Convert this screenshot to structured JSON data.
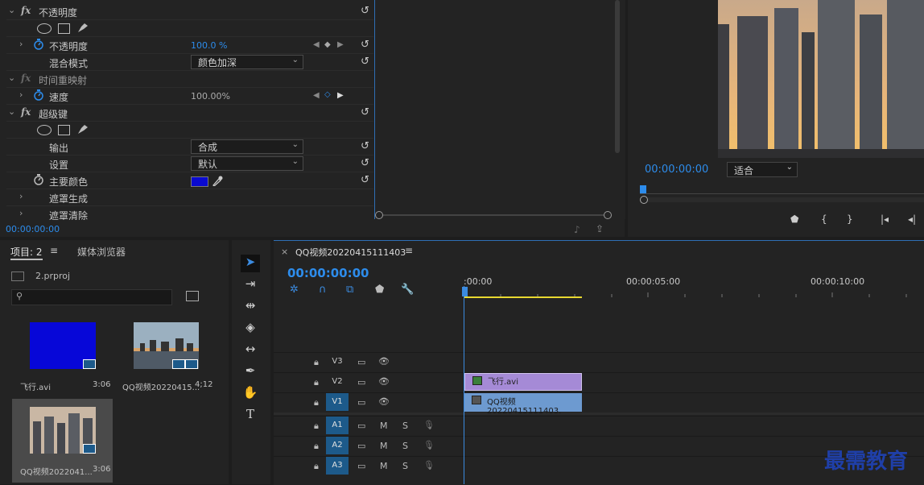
{
  "effects": {
    "opacity_title": "不透明度",
    "opacity_label": "不透明度",
    "opacity_value": "100.0 %",
    "blend_label": "混合模式",
    "blend_value": "颜色加深",
    "time_remap_title": "时间重映射",
    "speed_label": "速度",
    "speed_value": "100.00%",
    "ultrakey_title": "超级键",
    "output_label": "输出",
    "output_value": "合成",
    "settings_label": "设置",
    "settings_value": "默认",
    "key_color_label": "主要颜色",
    "key_color": "#0a0ad0",
    "matte_gen_label": "遮罩生成",
    "matte_clean_label": "遮罩清除",
    "fx_symbol": "fx",
    "timecode": "00:00:00:00"
  },
  "program": {
    "timecode": "00:00:00:00",
    "fit_value": "适合"
  },
  "project": {
    "tab_project": "项目: 2",
    "tab_media": "媒体浏览器",
    "file": "2.prproj",
    "items": [
      {
        "name": "飞行.avi",
        "duration": "3:06",
        "color": "#0707d8"
      },
      {
        "name": "QQ视频20220415...",
        "duration": "4;12"
      },
      {
        "name": "QQ视频2022041...",
        "duration": "3:06"
      }
    ]
  },
  "timeline": {
    "sequence_name": "QQ视频20220415111403",
    "timecode": "00:00:00:00",
    "ticks": [
      ":00:00",
      "00:00:05:00",
      "00:00:10:00"
    ],
    "tracks": [
      {
        "name": "V3"
      },
      {
        "name": "V2"
      },
      {
        "name": "V1"
      },
      {
        "name": "A1"
      },
      {
        "name": "A2"
      },
      {
        "name": "A3"
      }
    ],
    "audio_m": "M",
    "audio_s": "S",
    "clip_v2": "飞行.avi",
    "clip_v1": "QQ视频20220415111403.",
    "clip_v2_color": "#a58ad6",
    "clip_v1_color": "#6d9ad0"
  },
  "watermark": "最需教育"
}
